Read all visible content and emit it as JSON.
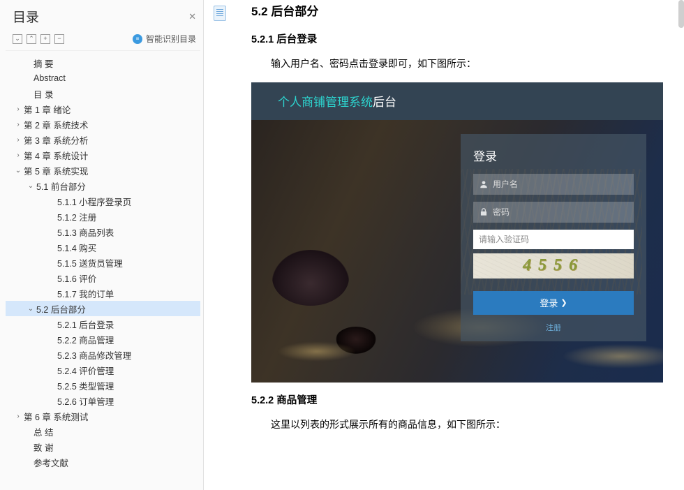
{
  "sidebar": {
    "title": "目录",
    "smart_toc": "智能识别目录",
    "items": [
      {
        "label": "摘  要",
        "level": "lvl0",
        "chev": ""
      },
      {
        "label": "Abstract",
        "level": "lvl0",
        "chev": ""
      },
      {
        "label": "目  录",
        "level": "lvl0",
        "chev": ""
      },
      {
        "label": "第 1 章  绪论",
        "level": "lvl0c",
        "chev": "›"
      },
      {
        "label": "第 2 章  系统技术",
        "level": "lvl0c",
        "chev": "›"
      },
      {
        "label": "第 3 章  系统分析",
        "level": "lvl0c",
        "chev": "›"
      },
      {
        "label": "第 4 章  系统设计",
        "level": "lvl0c",
        "chev": "›"
      },
      {
        "label": "第 5 章  系统实现",
        "level": "lvl0c",
        "chev": "⌄"
      },
      {
        "label": "5.1 前台部分",
        "level": "lvl1",
        "chev": "⌄"
      },
      {
        "label": "5.1.1 小程序登录页",
        "level": "lvl2",
        "chev": ""
      },
      {
        "label": "5.1.2 注册",
        "level": "lvl2",
        "chev": ""
      },
      {
        "label": "5.1.3 商品列表",
        "level": "lvl2",
        "chev": ""
      },
      {
        "label": "5.1.4 购买",
        "level": "lvl2",
        "chev": ""
      },
      {
        "label": "5.1.5 送货员管理",
        "level": "lvl2",
        "chev": ""
      },
      {
        "label": "5.1.6 评价",
        "level": "lvl2",
        "chev": ""
      },
      {
        "label": "5.1.7 我的订单",
        "level": "lvl2",
        "chev": ""
      },
      {
        "label": "5.2 后台部分",
        "level": "lvl1",
        "chev": "⌄",
        "active": true
      },
      {
        "label": "5.2.1 后台登录",
        "level": "lvl2",
        "chev": ""
      },
      {
        "label": "5.2.2 商品管理",
        "level": "lvl2",
        "chev": ""
      },
      {
        "label": "5.2.3 商品修改管理",
        "level": "lvl2",
        "chev": ""
      },
      {
        "label": "5.2.4 评价管理",
        "level": "lvl2",
        "chev": ""
      },
      {
        "label": "5.2.5 类型管理",
        "level": "lvl2",
        "chev": ""
      },
      {
        "label": "5.2.6 订单管理",
        "level": "lvl2",
        "chev": ""
      },
      {
        "label": "第 6 章  系统测试",
        "level": "lvl0c",
        "chev": "›"
      },
      {
        "label": "总  结",
        "level": "lvl0",
        "chev": ""
      },
      {
        "label": "致  谢",
        "level": "lvl0",
        "chev": ""
      },
      {
        "label": "参考文献",
        "level": "lvl0",
        "chev": ""
      }
    ]
  },
  "doc": {
    "h2": "5.2  后台部分",
    "h3a": "5.2.1  后台登录",
    "p1": "输入用户名、密码点击登录即可，如下图所示：",
    "h3b": "5.2.2  商品管理",
    "p2": "这里以列表的形式展示所有的商品信息，如下图所示："
  },
  "screenshot": {
    "title_a": "个人商铺管理系统",
    "title_b": "后台",
    "login_title": "登录",
    "username_ph": "用户名",
    "password_ph": "密码",
    "captcha_ph": "请输入验证码",
    "captcha_code": "4556",
    "login_btn": "登录",
    "register": "注册"
  }
}
